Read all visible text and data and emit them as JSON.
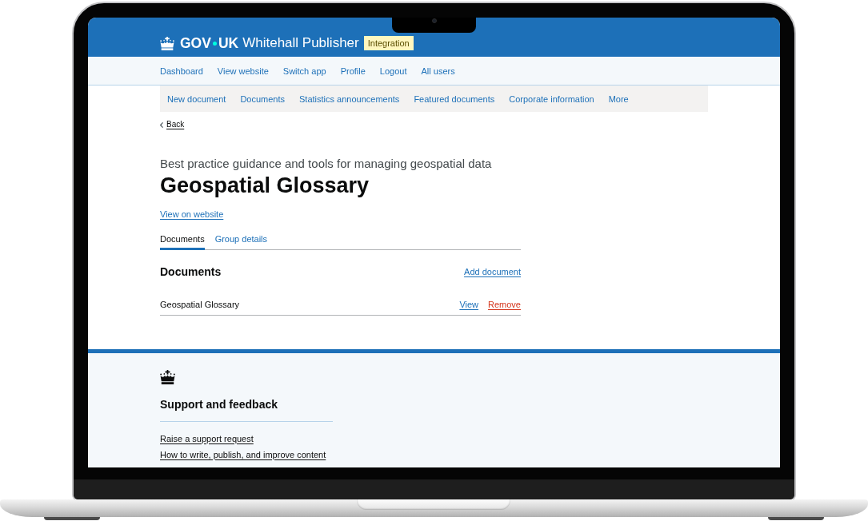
{
  "header": {
    "logo": {
      "left": "GOV",
      "right": "UK"
    },
    "app_name": "Whitehall Publisher",
    "environment_tag": "Integration"
  },
  "nav": {
    "items": [
      "Dashboard",
      "View website",
      "Switch app",
      "Profile",
      "Logout",
      "All users"
    ]
  },
  "sub_nav": {
    "items": [
      "New document",
      "Documents",
      "Statistics announcements",
      "Featured documents",
      "Corporate information",
      "More"
    ]
  },
  "back_link": "Back",
  "caption": "Best practice guidance and tools for managing geospatial data",
  "title": "Geospatial Glossary",
  "view_link": "View on website",
  "tabs": [
    {
      "label": "Documents",
      "selected": true
    },
    {
      "label": "Group details",
      "selected": false
    }
  ],
  "documents": {
    "heading": "Documents",
    "add_link": "Add document",
    "rows": [
      {
        "title": "Geospatial Glossary",
        "actions": [
          {
            "label": "View",
            "kind": "link"
          },
          {
            "label": "Remove",
            "kind": "danger"
          }
        ]
      }
    ]
  },
  "footer": {
    "heading": "Support and feedback",
    "links": [
      "Raise a support request",
      "How to write, publish, and improve content"
    ]
  }
}
